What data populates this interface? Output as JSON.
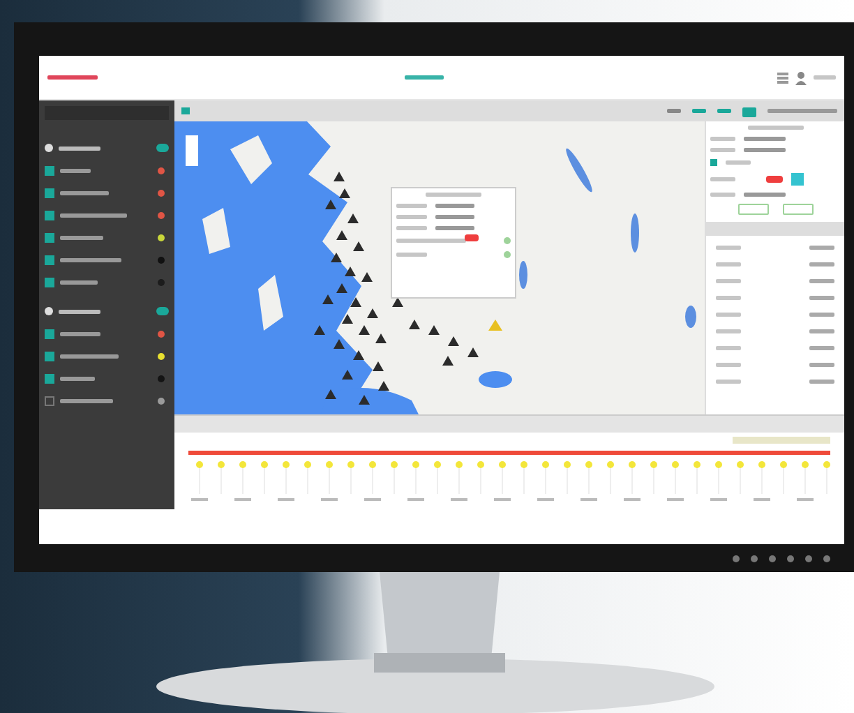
{
  "sidebar": {
    "groups": [
      {
        "on": true,
        "items": [
          {
            "checked": true,
            "color": "#e05545"
          },
          {
            "checked": true,
            "color": "#e05545"
          },
          {
            "checked": true,
            "color": "#e05545"
          },
          {
            "checked": true,
            "color": "#c8d63a"
          },
          {
            "checked": true,
            "color": "#111111"
          },
          {
            "checked": true,
            "color": "#1c1c1c"
          }
        ]
      },
      {
        "on": true,
        "items": [
          {
            "checked": true,
            "color": "#e05545"
          },
          {
            "checked": true,
            "color": "#e8e030"
          },
          {
            "checked": true,
            "color": "#141414"
          },
          {
            "checked": false,
            "color": "#9a9a9a"
          }
        ]
      }
    ]
  }
}
